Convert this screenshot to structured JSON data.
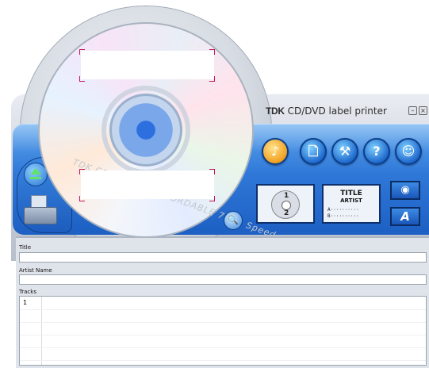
{
  "window": {
    "brand": "TDK",
    "title": "CD/DVD label printer",
    "minimize_glyph": "–",
    "close_glyph": "×"
  },
  "disc": {
    "brand_text": "TDK CD-R80",
    "sub_text": "CD-RECORDABLE 700 · Speed"
  },
  "toolbar": {
    "buttons": [
      {
        "icon": "music-note-icon",
        "glyph": "♪"
      },
      {
        "icon": "new-document-icon",
        "glyph": "🗋"
      },
      {
        "icon": "wrench-icon",
        "glyph": "⚒"
      },
      {
        "icon": "help-icon",
        "glyph": "?"
      },
      {
        "icon": "person-icon",
        "glyph": "☺"
      }
    ]
  },
  "layouts": {
    "disc_label_1": "1",
    "disc_label_2": "2",
    "text_title": "TITLE",
    "text_artist": "ARTIST",
    "text_row_a": "A··········",
    "text_row_b": "B··········"
  },
  "side_buttons": {
    "eye_glyph": "◉",
    "font_glyph": "A"
  },
  "zoom_glyph": "🔍",
  "form": {
    "title_label": "Title",
    "title_value": "",
    "artist_label": "Artist Name",
    "artist_value": "",
    "tracks_label": "Tracks",
    "tracks": [
      "1"
    ]
  },
  "colors": {
    "panel_blue": "#2f78d8",
    "active_button": "#f0a020",
    "accent_green": "#5fe36a",
    "crop_mark": "#c2185b"
  }
}
